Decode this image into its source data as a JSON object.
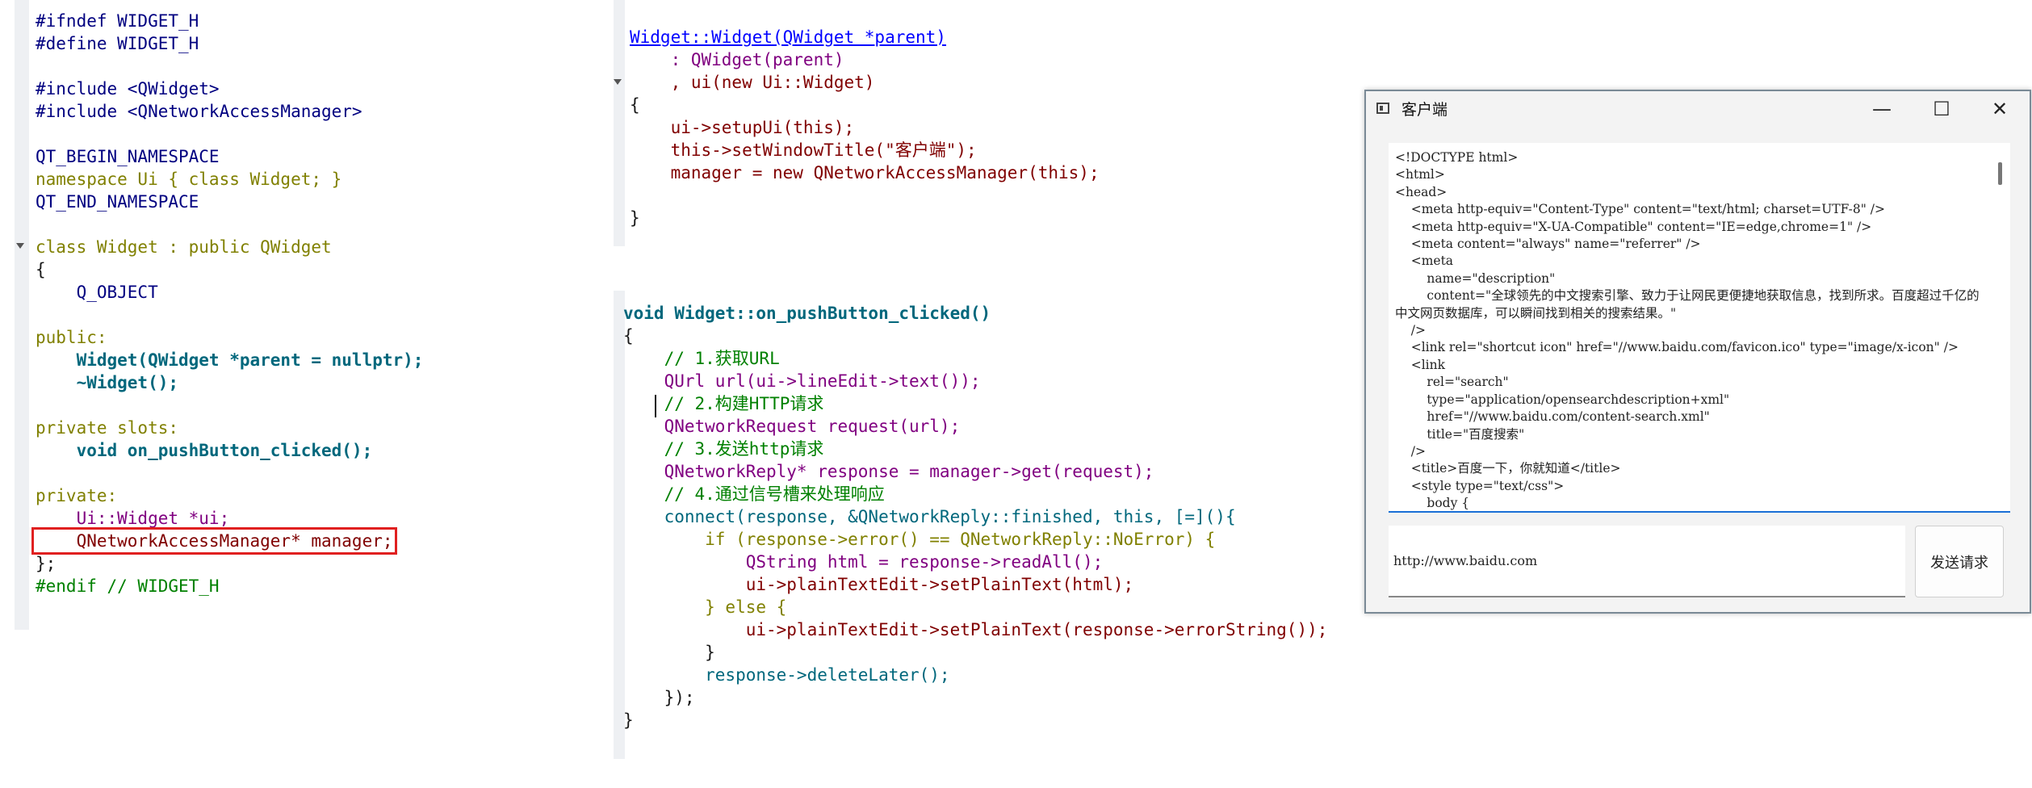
{
  "header_file": {
    "lines": [
      "#ifndef WIDGET_H",
      "#define WIDGET_H",
      "",
      "#include <QWidget>",
      "#include <QNetworkAccessManager>",
      "",
      "QT_BEGIN_NAMESPACE",
      "namespace Ui { class Widget; }",
      "QT_END_NAMESPACE",
      "",
      "class Widget : public QWidget",
      "{",
      "    Q_OBJECT",
      "",
      "public:",
      "    Widget(QWidget *parent = nullptr);",
      "    ~Widget();",
      "",
      "private slots:",
      "    void on_pushButton_clicked();",
      "",
      "private:",
      "    Ui::Widget *ui;",
      "    QNetworkAccessManager* manager;",
      "};",
      "#endif // WIDGET_H"
    ]
  },
  "constructor": {
    "lines": [
      "Widget::Widget(QWidget *parent)",
      "    : QWidget(parent)",
      "    , ui(new Ui::Widget)",
      "{",
      "    ui->setupUi(this);",
      "    this->setWindowTitle(\"客户端\");",
      "    manager = new QNetworkAccessManager(this);",
      "",
      "}"
    ]
  },
  "slot_function": {
    "lines": [
      "void Widget::on_pushButton_clicked()",
      "{",
      "    // 1.获取URL",
      "    QUrl url(ui->lineEdit->text());",
      "    // 2.构建HTTP请求",
      "    QNetworkRequest request(url);",
      "    // 3.发送http请求",
      "    QNetworkReply* response = manager->get(request);",
      "    // 4.通过信号槽来处理响应",
      "    connect(response, &QNetworkReply::finished, this, [=](){",
      "        if (response->error() == QNetworkReply::NoError) {",
      "            QString html = response->readAll();",
      "            ui->plainTextEdit->setPlainText(html);",
      "        } else {",
      "            ui->plainTextEdit->setPlainText(response->errorString());",
      "        }",
      "        response->deleteLater();",
      "    });",
      "}"
    ]
  },
  "window": {
    "title": "客户端",
    "minimize": "—",
    "maximize": "☐",
    "close": "✕",
    "html_content": "<!DOCTYPE html>\n<html>\n<head>\n    <meta http-equiv=\"Content-Type\" content=\"text/html; charset=UTF-8\" />\n    <meta http-equiv=\"X-UA-Compatible\" content=\"IE=edge,chrome=1\" />\n    <meta content=\"always\" name=\"referrer\" />\n    <meta\n        name=\"description\"\n        content=\"全球领先的中文搜索引擎、致力于让网民更便捷地获取信息，找到所求。百度超过千亿的中文网页数据库，可以瞬间找到相关的搜索结果。\"\n    />\n    <link rel=\"shortcut icon\" href=\"//www.baidu.com/favicon.ico\" type=\"image/x-icon\" />\n    <link\n        rel=\"search\"\n        type=\"application/opensearchdescription+xml\"\n        href=\"//www.baidu.com/content-search.xml\"\n        title=\"百度搜索\"\n    />\n    <title>百度一下，你就知道</title>\n    <style type=\"text/css\">\n        body {",
    "url_value": "http://www.baidu.com",
    "send_label": "发送请求"
  }
}
